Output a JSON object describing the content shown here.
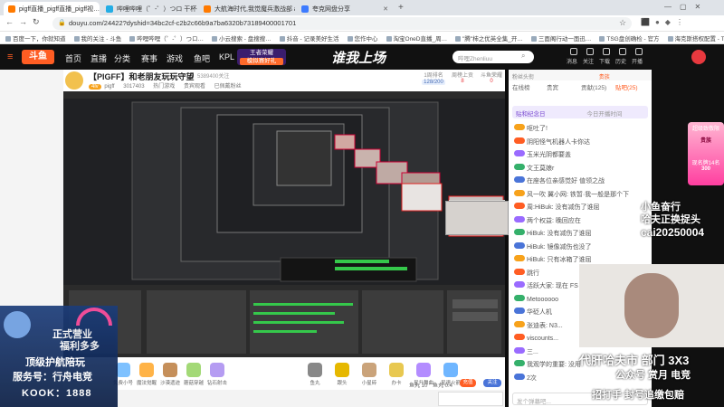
{
  "tabs": [
    {
      "label": "pigff直播_pigff直播_pigff视…",
      "color": "#ff7a00"
    },
    {
      "label": "哔哩哔哩（゜-゜）つロ 干杯--b…",
      "color": "#23ade5"
    },
    {
      "label": "大航海时代,我觉魔兵激战部 ai…",
      "color": "#ff7a00"
    },
    {
      "label": "夸克网盘分享",
      "color": "#3d7bff"
    }
  ],
  "url": "douyu.com/24422?dyshid=34bc2cf-c2b2c66b9a7ba6320b73189400001701",
  "bookmarks": [
    "百度一下，你就知道",
    "我的关注 - 斗鱼",
    "哔哩哔哩（゜-゜）つロ…",
    "小云搜索 - 盘搜搜…",
    "抖音 - 记录美好生活",
    "您作中心",
    "淘宝OneD直播_周…",
    "\"腾\"柿之优英全集_开…",
    "三面阁行动一面迅…",
    "TSG盘创确检 - 官方",
    "海克斯搭权配置 - T…"
  ],
  "topnav": {
    "logo": "斗鱼",
    "items": [
      "首页",
      "直播",
      "分类",
      "赛事",
      "游戏",
      "鱼吧",
      "KPL"
    ],
    "promo": "王者荣耀",
    "promo_sub": "模拟赛好礼",
    "banner": "谁我上场",
    "search_placeholder": "哔哩Zhenliuu",
    "right": [
      "消息",
      "关注",
      "下载",
      "历史",
      "开播"
    ]
  },
  "stream": {
    "title": "【PIGFF】和老朋友玩玩守望",
    "streamer": "pigff",
    "id": "3017403",
    "tags": [
      "热门游戏",
      "贵宾观看",
      "已佩戴粉丝"
    ],
    "fans_label": "5389400关注",
    "rank_a_label": "1周排名",
    "rank_a": "128/200",
    "rank_b_label": "周榜上贡",
    "rank_b": "8",
    "rank_c_label": "斗鱼荣耀",
    "rank_c": "0"
  },
  "overlay": {
    "rainbow_lines": [
      "正式营业",
      "福利多多",
      "顶级护航陪玩"
    ],
    "service": "服务号：行舟电竞",
    "kook": "KOOK：1888",
    "marquee_a": [
      "小鱼奋行",
      "哈夫正换捉头"
    ],
    "wechat": "cai20250004",
    "banner": "代肝哈夫市 部门 3X3",
    "subbanner": "公众号 赏月 电竞",
    "footer": "招打手 封号追缴包赔"
  },
  "bottombar": {
    "gifts": [
      "免费小号",
      "魔法觉醒",
      "沙漠遗迹",
      "蘑菇穿越",
      "钻石射击"
    ],
    "gifts2": [
      "鱼丸",
      "跟头",
      "小星砖",
      "办卡",
      "星升舞曲",
      "星速火箭"
    ],
    "fishball": "鱼丸 10",
    "fishbar": "鱼丸 0.4",
    "recharge": "充值",
    "follow": "关注"
  },
  "rightpanel": {
    "tabs": [
      "在线榜",
      "贵宾",
      "贡献(125)",
      "贴吧(25)"
    ],
    "nobles": "贵族",
    "rank_label": "粉丝头衔",
    "chat_title": "贴和纪念日",
    "chat_date": "今日开播时间",
    "chat": [
      "呕吐了!",
      "阴阳怪气机器人卡你达",
      "玉米光阴都要盖",
      "文王莫娘r",
      "在座各位亲感觉好 值领之战",
      "风一吹 翼小网: 铁暂·我一般是那个下",
      "周:HiBuk: 没有减伤了谁屈",
      "两个权益: 晚回应在",
      "HiBuk: 没有减伤了谁屈",
      "HiBuk: 镜像减伤也没了",
      "HiBuk: 只有冰箱了谁屈",
      "跳行",
      "活跃大家: 现在 FS 增比路线构",
      "Metoooooo",
      "华砭人机",
      "张迪表: N3...",
      "viscounts...",
      "三...",
      "我观学的重要: 没用",
      "2次"
    ],
    "send_placeholder": "发个弹幕吧..."
  },
  "rightmost": {
    "label": "超级致敬限",
    "badge": "贵族",
    "cash": "现名牌14名",
    "amount": "300"
  }
}
